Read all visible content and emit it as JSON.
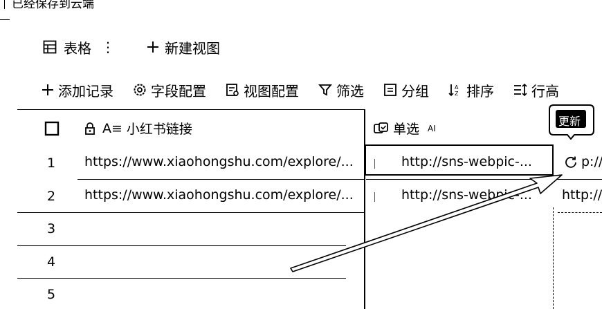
{
  "status": {
    "text": "已经保存到云端"
  },
  "view_bar": {
    "table_label": "表格",
    "more_glyph": "⋮",
    "new_view_label": "新建视图"
  },
  "toolbar": {
    "add_record": "添加记录",
    "field_config": "字段配置",
    "view_config": "视图配置",
    "filter": "筛选",
    "group": "分组",
    "sort": "排序",
    "row_height": "行高"
  },
  "columns": {
    "link": {
      "type_glyph": "A≡",
      "label": "小红书链接"
    },
    "single": {
      "label": "单选",
      "ai": "AI"
    }
  },
  "tooltip": {
    "label": "更新"
  },
  "rows": [
    {
      "num": "1",
      "link": "https://www.xiaohongshu.com/explore/...",
      "single": "http://sns-webpic-...",
      "col3": "p://"
    },
    {
      "num": "2",
      "link": "https://www.xiaohongshu.com/explore/...",
      "single": "http://sns-webpic-...",
      "col3": "http://"
    },
    {
      "num": "3",
      "link": "",
      "single": "",
      "col3": ""
    },
    {
      "num": "4",
      "link": "",
      "single": "",
      "col3": ""
    },
    {
      "num": "5",
      "link": "",
      "single": "",
      "col3": ""
    }
  ]
}
